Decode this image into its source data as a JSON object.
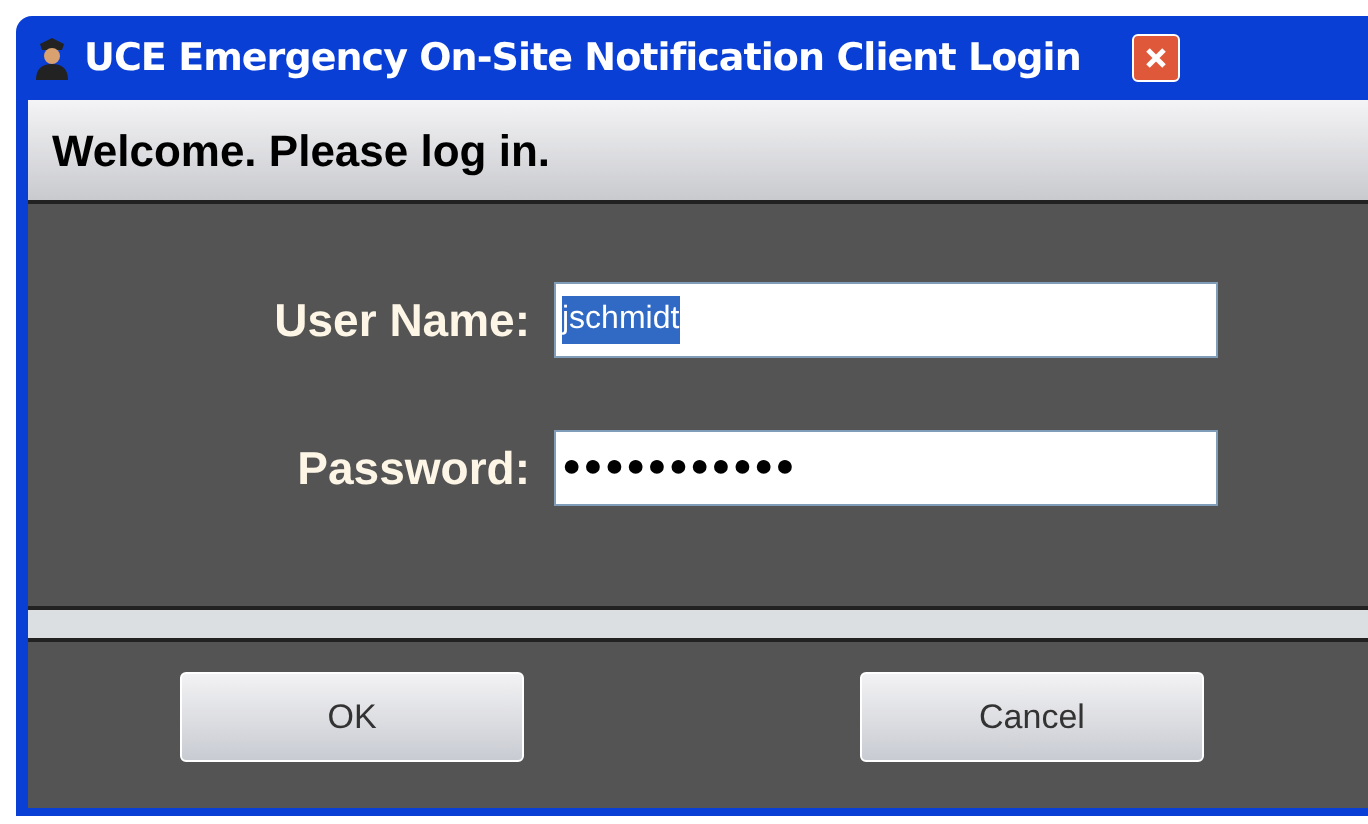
{
  "window": {
    "title": "UCE Emergency On-Site Notification Client Login"
  },
  "header": "Welcome. Please log in.",
  "fields": [
    {
      "label": "User Name:",
      "value": "jschmidt",
      "highlighted": true
    },
    {
      "label": "Password:",
      "value": "●●●●●●●●●●●",
      "highlighted": false
    }
  ],
  "buttons": [
    "OK",
    "Cancel"
  ]
}
